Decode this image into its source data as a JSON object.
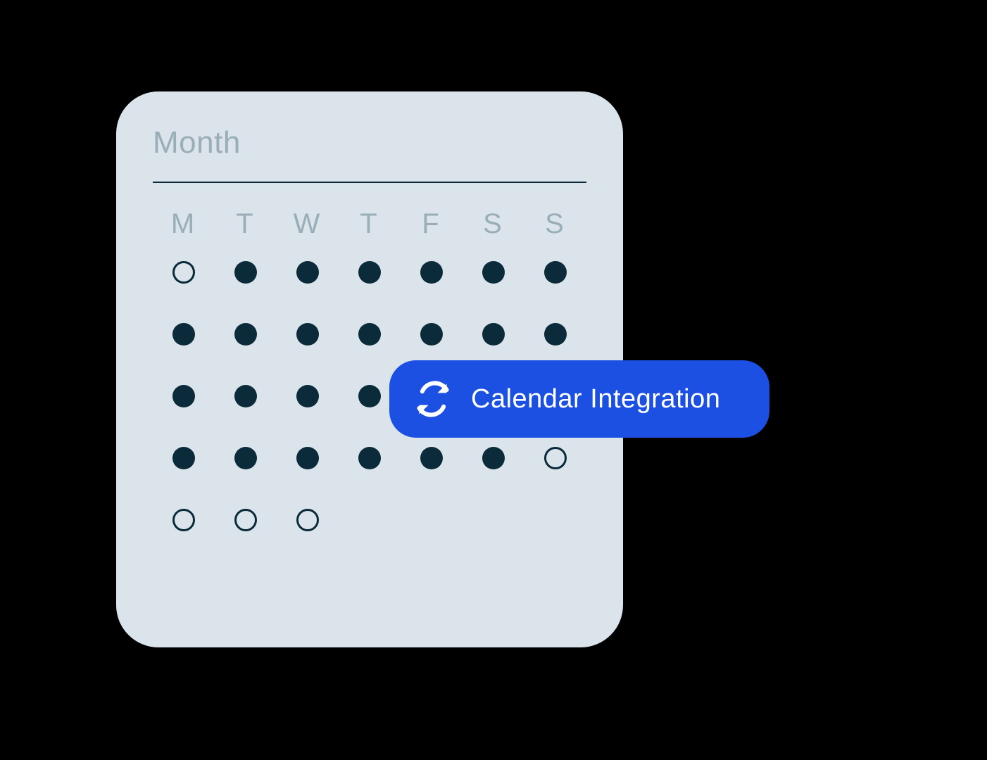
{
  "calendar": {
    "title": "Month",
    "weekdays": [
      "M",
      "T",
      "W",
      "T",
      "F",
      "S",
      "S"
    ],
    "days": [
      [
        "hollow",
        "filled",
        "filled",
        "filled",
        "filled",
        "filled",
        "filled"
      ],
      [
        "filled",
        "filled",
        "filled",
        "filled",
        "filled",
        "filled",
        "filled"
      ],
      [
        "filled",
        "filled",
        "filled",
        "filled",
        "filled",
        "filled",
        "filled"
      ],
      [
        "filled",
        "filled",
        "filled",
        "filled",
        "filled",
        "filled",
        "hollow"
      ],
      [
        "hollow",
        "hollow",
        "hollow",
        "empty",
        "empty",
        "empty",
        "empty"
      ]
    ]
  },
  "integration": {
    "label": "Calendar Integration",
    "icon": "refresh-icon"
  },
  "colors": {
    "card_bg": "#DAE4EA",
    "muted_text": "#9AAEB8",
    "dark": "#0B2A3A",
    "accent": "#1C50E3",
    "white": "#FFFFFF",
    "page_bg": "#000000"
  }
}
